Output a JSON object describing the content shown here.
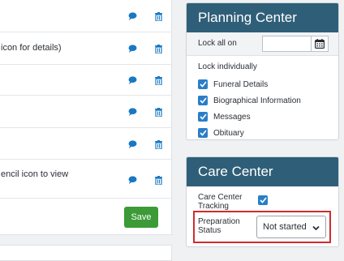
{
  "left_list": {
    "rows": [
      {
        "text": ""
      },
      {
        "text": "icon for details)"
      },
      {
        "text": ""
      },
      {
        "text": ""
      },
      {
        "text": ""
      },
      {
        "text": "encil icon to view"
      }
    ],
    "save_label": "Save"
  },
  "planning_center": {
    "title": "Planning Center",
    "lock_all_label": "Lock all on",
    "lock_all_value": "",
    "lock_individually_label": "Lock individually",
    "items": [
      {
        "label": "Funeral Details",
        "checked": true
      },
      {
        "label": "Biographical Information",
        "checked": true
      },
      {
        "label": "Messages",
        "checked": true
      },
      {
        "label": "Obituary",
        "checked": true
      }
    ]
  },
  "care_center": {
    "title": "Care Center",
    "tracking_label_line1": "Care Center",
    "tracking_label_line2": "Tracking",
    "tracking_checked": true,
    "prep_label_line1": "Preparation",
    "prep_label_line2": "Status",
    "prep_value": "Not started"
  },
  "colors": {
    "header_bg": "#2f5f78",
    "accent_blue": "#2a7ec8",
    "icon_blue": "#1a78c2",
    "save_green": "#3c9a37",
    "highlight_red": "#d12c2c"
  },
  "icons": [
    "comment-icon",
    "trash-icon",
    "calendar-icon",
    "check-icon",
    "chevron-down-icon"
  ]
}
